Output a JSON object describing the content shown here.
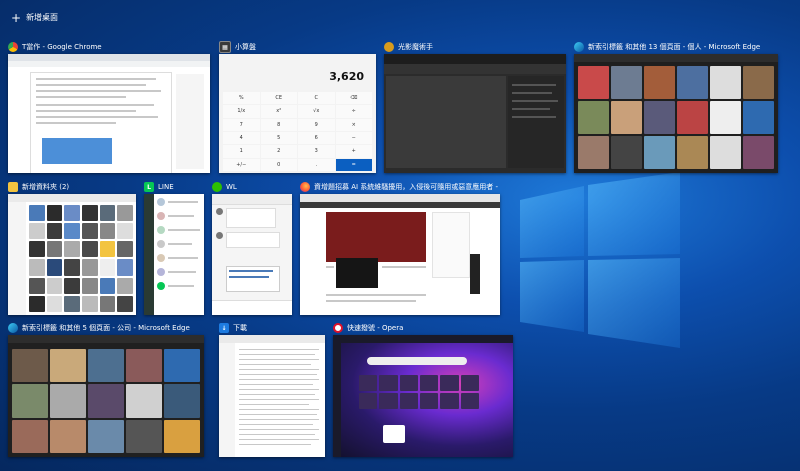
{
  "new_desktop_label": "新增桌面",
  "windows": {
    "chrome": {
      "title": "T當作 - Google Chrome",
      "icon": "chrome-icon"
    },
    "calc": {
      "title": "小算盤",
      "icon": "calculator-icon",
      "display": "3,620",
      "keys": [
        "%",
        "CE",
        "C",
        "⌫",
        "1/x",
        "x²",
        "√x",
        "÷",
        "7",
        "8",
        "9",
        "×",
        "4",
        "5",
        "6",
        "−",
        "1",
        "2",
        "3",
        "+",
        "+/−",
        "0",
        ".",
        "="
      ]
    },
    "photo": {
      "title": "光影魔術手",
      "icon": "photo-editor-icon"
    },
    "edge1": {
      "title": "新索引標籤 和其他 13 個頁面 - 個人 - Microsoft Edge",
      "icon": "edge-icon"
    },
    "explorer": {
      "title": "新增資料夾 (2)",
      "icon": "folder-icon"
    },
    "line": {
      "title": "LINE",
      "icon": "line-icon"
    },
    "wl": {
      "title": "WL",
      "icon": "wechat-icon"
    },
    "firefox": {
      "title": "資增題招募 AI 系統維騷擾用，入侵後可隨用或惡意應用者 - IT之家 —...",
      "icon": "firefox-icon"
    },
    "edge2": {
      "title": "新索引標籤 和其他 5 個頁面 - 公司 - Microsoft Edge",
      "icon": "edge-icon"
    },
    "downloads": {
      "title": "下載",
      "icon": "download-icon"
    },
    "opera": {
      "title": "快速撥號 - Opera",
      "icon": "opera-icon"
    }
  },
  "colors": {
    "accent": "#0b5fc1",
    "desktop_bg": "#0d4fae",
    "line_green": "#06c755"
  }
}
